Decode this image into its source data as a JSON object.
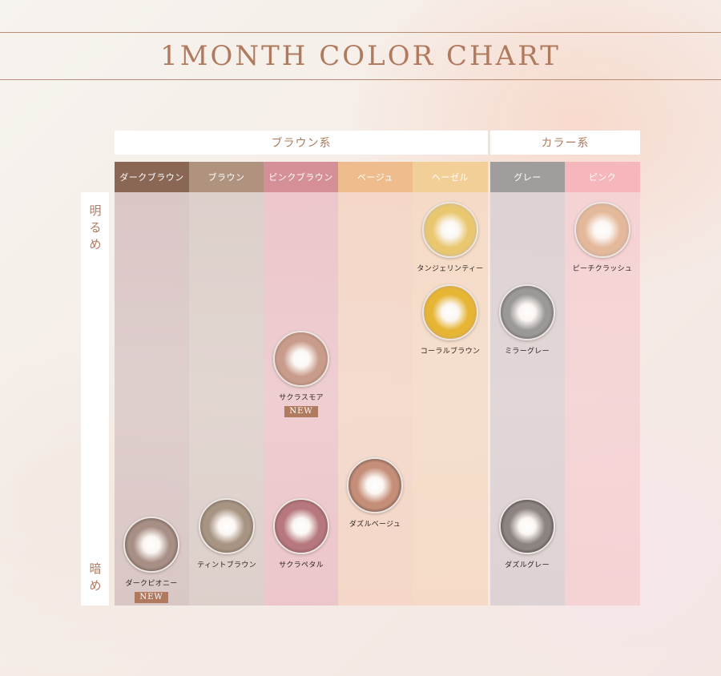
{
  "title": "1MONTH COLOR CHART",
  "groups": [
    {
      "label": "ブラウン系"
    },
    {
      "label": "カラー系"
    }
  ],
  "columns": [
    {
      "label": "ダークブラウン",
      "color": "#8a6654",
      "bg": "#d9c7c6"
    },
    {
      "label": "ブラウン",
      "color": "#b0937f",
      "bg": "#ddd0cb"
    },
    {
      "label": "ピンクブラウン",
      "color": "#d58f97",
      "bg": "#ecc6cb"
    },
    {
      "label": "ベージュ",
      "color": "#eebc8d",
      "bg": "#f4d7c8"
    },
    {
      "label": "ヘーゼル",
      "color": "#f1cf97",
      "bg": "#f5dbc7"
    },
    {
      "label": "グレー",
      "color": "#a09d9c",
      "bg": "#ddd2d4"
    },
    {
      "label": "ピンク",
      "color": "#f5b7bb",
      "bg": "#f5d2d4"
    }
  ],
  "scale": {
    "bright": "明るめ",
    "dark": "暗め"
  },
  "lenses": [
    {
      "name": "タンジェリンティー",
      "new": "",
      "iris": "#e9c76f",
      "outer": "#c9b6a3"
    },
    {
      "name": "ピーチクラッシュ",
      "new": "",
      "iris": "#e4b89a",
      "outer": "#bfa89e"
    },
    {
      "name": "コーラルブラウン",
      "new": "",
      "iris": "#e6b534",
      "outer": "#c6a06a"
    },
    {
      "name": "ミラーグレー",
      "new": "",
      "iris": "#9b9898",
      "outer": "#5e5a5a"
    },
    {
      "name": "サクラスモア",
      "new": "NEW",
      "iris": "#c89b8a",
      "outer": "#9e7a70"
    },
    {
      "name": "ダズルベージュ",
      "new": "",
      "iris": "#c58e78",
      "outer": "#5a4640"
    },
    {
      "name": "ティントブラウン",
      "new": "",
      "iris": "#a89482",
      "outer": "#6e6258"
    },
    {
      "name": "サクラペタル",
      "new": "",
      "iris": "#b6787e",
      "outer": "#7e5058"
    },
    {
      "name": "ダズルグレー",
      "new": "",
      "iris": "#8d8482",
      "outer": "#3e3838"
    },
    {
      "name": "ダークピオニー",
      "new": "NEW",
      "iris": "#a88f85",
      "outer": "#5e4e4a"
    }
  ]
}
